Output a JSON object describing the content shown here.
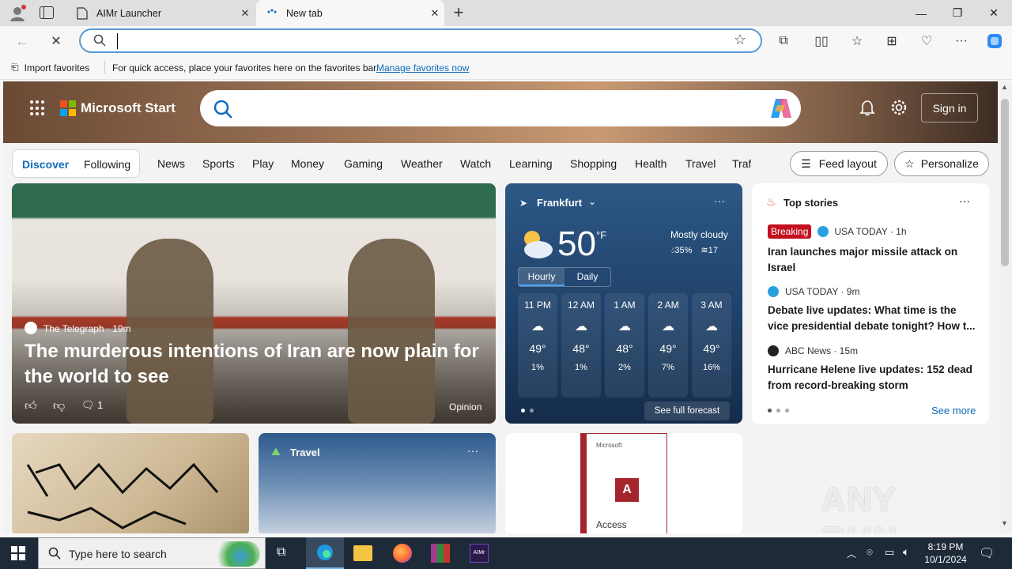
{
  "browser": {
    "tabs": [
      {
        "title": "AIMr Launcher"
      },
      {
        "title": "New tab"
      }
    ],
    "address": {
      "value": "",
      "placeholder": ""
    },
    "favorites_bar": {
      "import_label": "Import favorites",
      "message": "For quick access, place your favorites here on the favorites bar.",
      "manage_link": "Manage favorites now"
    }
  },
  "msstart": {
    "brand": "Microsoft Start",
    "sign_in": "Sign in",
    "nav": {
      "discover": "Discover",
      "following": "Following",
      "items": [
        "News",
        "Sports",
        "Play",
        "Money",
        "Gaming",
        "Weather",
        "Watch",
        "Learning",
        "Shopping",
        "Health",
        "Travel",
        "Traf"
      ],
      "feed_layout": "Feed layout",
      "personalize": "Personalize"
    },
    "hero_article": {
      "source": "The Telegraph",
      "age": "19m",
      "title": "The murderous intentions of Iran are now plain for the world to see",
      "comments": "1",
      "tag": "Opinion"
    },
    "weather": {
      "city": "Frankfurt",
      "temp": "50",
      "unit": "°F",
      "condition": "Mostly cloudy",
      "precip": "35%",
      "wind": "17",
      "tabs": [
        "Hourly",
        "Daily"
      ],
      "hours": [
        {
          "time": "11 PM",
          "temp": "49°",
          "precip": "1%"
        },
        {
          "time": "12 AM",
          "temp": "48°",
          "precip": "1%"
        },
        {
          "time": "1 AM",
          "temp": "48°",
          "precip": "2%"
        },
        {
          "time": "2 AM",
          "temp": "49°",
          "precip": "7%"
        },
        {
          "time": "3 AM",
          "temp": "49°",
          "precip": "16%"
        }
      ],
      "forecast_link": "See full forecast"
    },
    "top_stories": {
      "title": "Top stories",
      "items": [
        {
          "badge": "Breaking",
          "source": "USA TODAY · 1h",
          "headline": "Iran launches major missile attack on Israel"
        },
        {
          "source": "USA TODAY · 9m",
          "headline": "Debate live updates: What time is the vice presidential debate tonight? How t..."
        },
        {
          "source": "ABC News · 15m",
          "headline": "Hurricane Helene live updates: 152 dead from record-breaking storm"
        }
      ],
      "see_more": "See more"
    },
    "travel_card": {
      "title": "Travel"
    },
    "access_card": {
      "brand": "Microsoft",
      "product": "Access"
    }
  },
  "taskbar": {
    "search_placeholder": "Type here to search",
    "time": "8:19 PM",
    "date": "10/1/2024"
  },
  "watermark": "ANY RUN",
  "colors": {
    "accent": "#0f6cbd",
    "weather_bg": "#1e3f66",
    "breaking": "#c50f1f"
  }
}
